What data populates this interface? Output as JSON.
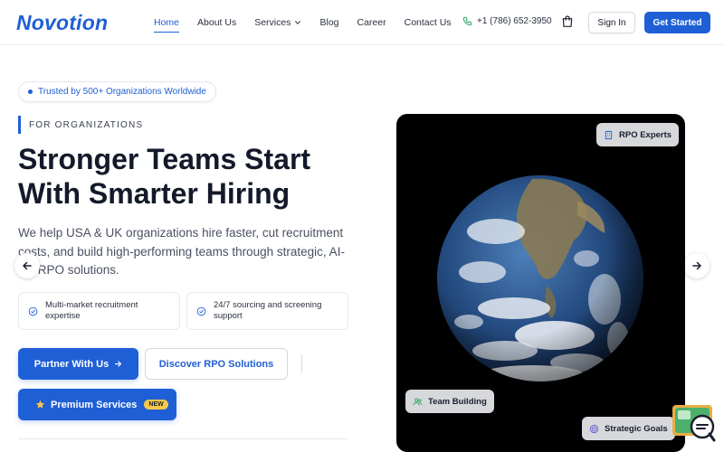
{
  "brand": {
    "name": "Novotion",
    "accent": "#1f5fd6"
  },
  "nav": {
    "items": [
      {
        "label": "Home",
        "active": true
      },
      {
        "label": "About Us"
      },
      {
        "label": "Services",
        "has_dropdown": true
      },
      {
        "label": "Blog"
      },
      {
        "label": "Career"
      },
      {
        "label": "Contact Us"
      }
    ],
    "phone": "+1 (786) 652-3950",
    "cart_icon": "cart-icon",
    "signin_label": "Sign In",
    "cta_label": "Get Started"
  },
  "hero": {
    "trusted_badge": "Trusted by 500+ Organizations Worldwide",
    "eyebrow": "FOR ORGANIZATIONS",
    "headline_line1": "Stronger Teams Start",
    "headline_line2": "With Smarter Hiring",
    "lead": "We help USA & UK organizations hire faster, cut recruitment costs, and build high-performing teams through strategic, AI-led RPO solutions.",
    "features": [
      {
        "text": "Multi-market recruitment expertise"
      },
      {
        "text": "24/7 sourcing and screening support"
      }
    ],
    "buttons": {
      "partner": "Partner With Us",
      "discover": "Discover RPO Solutions",
      "premium": "Premium Services",
      "premium_badge": "NEW"
    }
  },
  "image_panel": {
    "chips": {
      "rpo": "RPO Experts",
      "team": "Team Building",
      "goals": "Strategic Goals"
    }
  }
}
